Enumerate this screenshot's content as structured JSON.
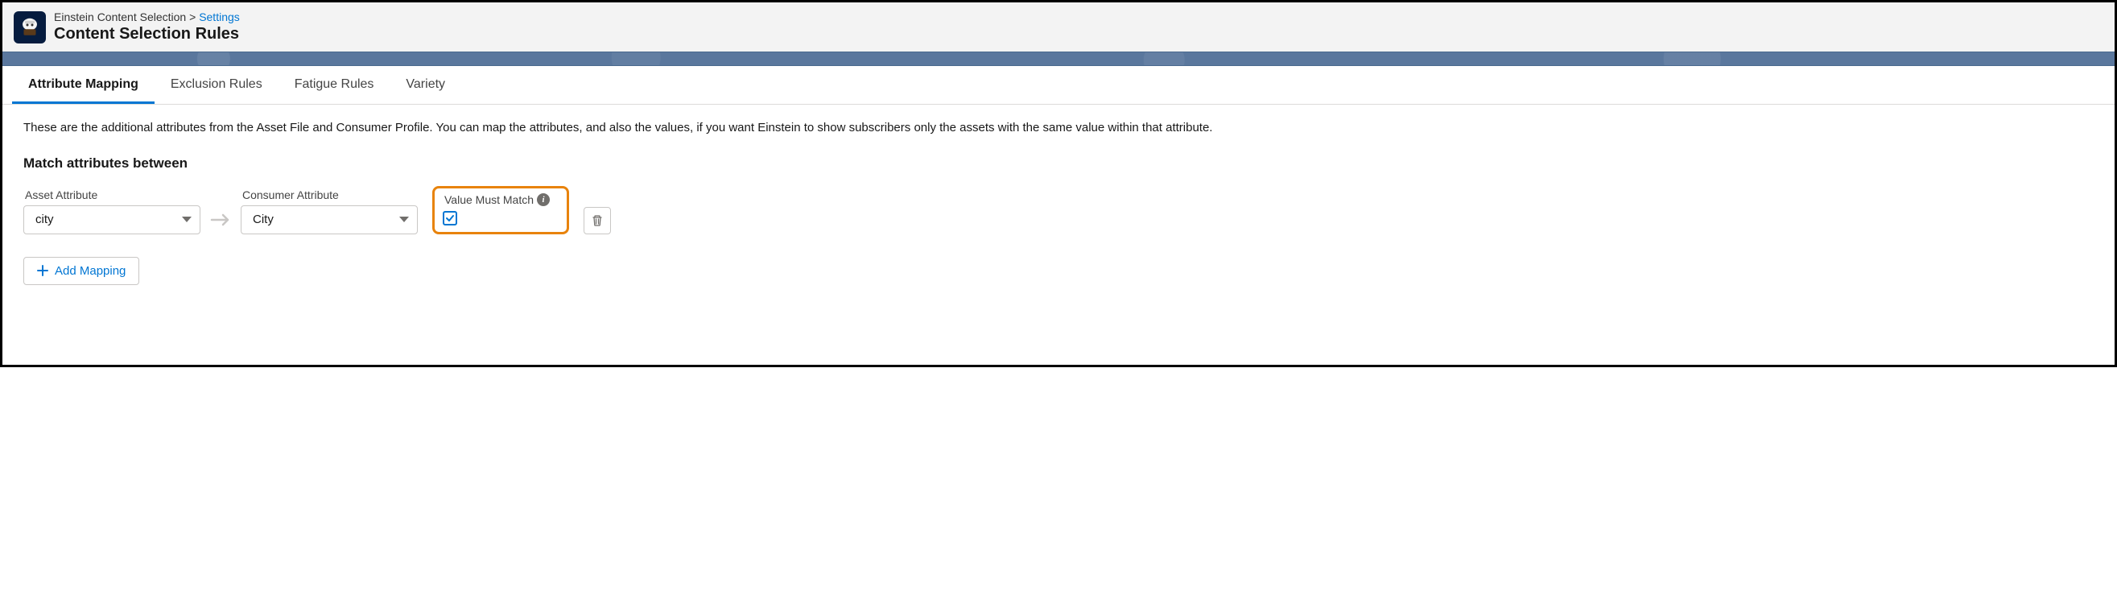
{
  "breadcrumb": {
    "root": "Einstein Content Selection",
    "current": "Settings"
  },
  "page_title": "Content Selection Rules",
  "tabs": [
    {
      "label": "Attribute Mapping",
      "active": true
    },
    {
      "label": "Exclusion Rules",
      "active": false
    },
    {
      "label": "Fatigue Rules",
      "active": false
    },
    {
      "label": "Variety",
      "active": false
    }
  ],
  "description": "These are the additional attributes from the Asset File and Consumer Profile. You can map the attributes, and also the values, if you want Einstein to show subscribers only the assets with the same value within that attribute.",
  "section_heading": "Match attributes between",
  "mapping": {
    "asset_label": "Asset Attribute",
    "asset_value": "city",
    "consumer_label": "Consumer Attribute",
    "consumer_value": "City",
    "must_match_label": "Value Must Match",
    "must_match_checked": true
  },
  "add_button": "Add Mapping"
}
